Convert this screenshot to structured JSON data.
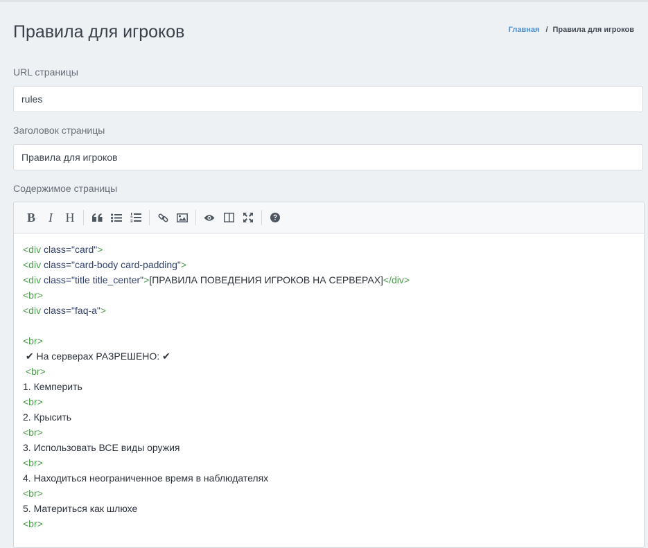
{
  "page": {
    "title": "Правила для игроков"
  },
  "breadcrumb": {
    "home": "Главная",
    "separator": "/",
    "current": "Правила для игроков"
  },
  "form": {
    "url_label": "URL страницы",
    "url_value": "rules",
    "heading_label": "Заголовок страницы",
    "heading_value": "Правила для игроков",
    "content_label": "Содержимое страницы"
  },
  "toolbar": {
    "bold": "B",
    "italic": "I",
    "heading": "H",
    "icons": [
      "bold-icon",
      "italic-icon",
      "heading-icon",
      "quote-icon",
      "unordered-list-icon",
      "ordered-list-icon",
      "link-icon",
      "image-icon",
      "preview-icon",
      "side-by-side-icon",
      "fullscreen-icon",
      "help-icon"
    ]
  },
  "editor": {
    "lines": [
      {
        "kind": "tag",
        "open": "<div ",
        "attr": "class=",
        "val": "\"card\"",
        "close": ">"
      },
      {
        "kind": "tag",
        "open": "<div ",
        "attr": "class=",
        "val": "\"card-body card-padding\"",
        "close": ">"
      },
      {
        "kind": "tagtext",
        "open": "<div ",
        "attr": "class=",
        "val": "\"title title_center\"",
        "close": ">",
        "text": "[ПРАВИЛА ПОВЕДЕНИЯ ИГРОКОВ НА СЕРВЕРАХ]",
        "end": "</div>"
      },
      {
        "kind": "plain-tag",
        "text": "<br>"
      },
      {
        "kind": "tag",
        "open": "<div ",
        "attr": "class=",
        "val": "\"faq-a\"",
        "close": ">"
      },
      {
        "kind": "blank"
      },
      {
        "kind": "plain-tag",
        "text": "<br>"
      },
      {
        "kind": "text",
        "text": " ✔ На серверах РАЗРЕШЕНО: ✔"
      },
      {
        "kind": "plain-tag",
        "text": " <br>"
      },
      {
        "kind": "text",
        "text": "1. Кемперить"
      },
      {
        "kind": "plain-tag",
        "text": "<br>"
      },
      {
        "kind": "text",
        "text": "2. Крысить"
      },
      {
        "kind": "plain-tag",
        "text": "<br>"
      },
      {
        "kind": "text",
        "text": "3. Использовать ВСЕ виды оружия"
      },
      {
        "kind": "plain-tag",
        "text": "<br>"
      },
      {
        "kind": "text",
        "text": "4. Находиться неограниченное время в наблюдателях"
      },
      {
        "kind": "plain-tag",
        "text": "<br>"
      },
      {
        "kind": "text",
        "text": "5. Материться как шлюхе"
      },
      {
        "kind": "plain-tag",
        "text": "<br>"
      }
    ]
  }
}
